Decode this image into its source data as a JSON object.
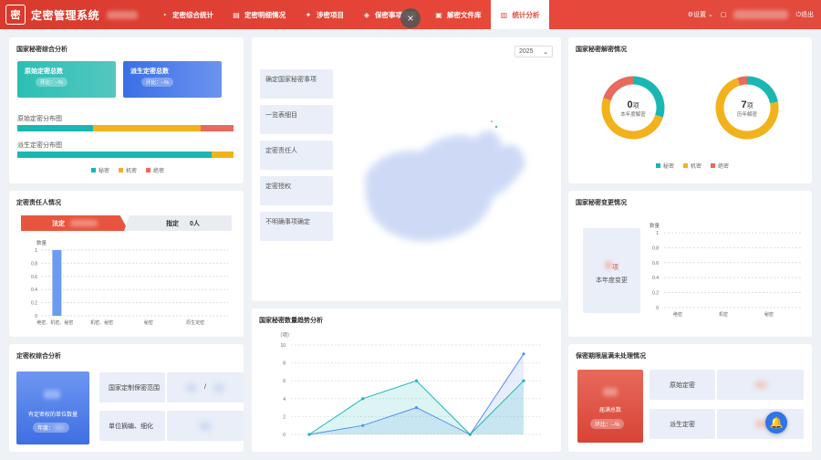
{
  "header": {
    "logo_char": "密",
    "title": "定密管理系统",
    "nav": [
      {
        "icon": "◔",
        "label": "定密综合统计"
      },
      {
        "icon": "▤",
        "label": "定密明细情况"
      },
      {
        "icon": "✦",
        "label": "涉密项目"
      },
      {
        "icon": "◈",
        "label": "保密事项范围"
      },
      {
        "icon": "▣",
        "label": "解密文件库"
      },
      {
        "icon": "▥",
        "label": "统计分析"
      }
    ],
    "close": "×",
    "settings": "设置",
    "logout": "退出"
  },
  "comp": {
    "title": "国家秘密综合分析",
    "orig_total": "原始定密总数",
    "derived_total": "派生定密总数",
    "ratio1": "环比：--%",
    "ratio2": "环比：--%",
    "orig_dist": "原始定密分布图",
    "derived_dist": "派生定密分布图",
    "legend": [
      {
        "name": "秘密",
        "color": "#19b7b4"
      },
      {
        "name": "机密",
        "color": "#f2b21c"
      },
      {
        "name": "绝密",
        "color": "#e86a5c"
      }
    ],
    "orig_bar": [
      0.35,
      0.5,
      0.15
    ],
    "derived_bar": [
      0.9,
      0.1,
      0
    ]
  },
  "resp": {
    "title": "定密责任人情况",
    "legal": "法定",
    "assigned": "指定",
    "assigned_count": "0人",
    "ylabel": "数量",
    "yticks": [
      "1",
      "0.8",
      "0.6",
      "0.4",
      "0.2",
      "0"
    ],
    "cats": [
      "绝密、机密、秘密",
      "机密、秘密",
      "秘密",
      "原生定密"
    ],
    "values": [
      1,
      0,
      0,
      0
    ]
  },
  "auth": {
    "title": "定密权综合分析",
    "box_label": "有定密权的单位数量",
    "year_label": "年度：",
    "scope_label": "国家定制保密范围",
    "slash": "/",
    "unit_label": "单位摘编、细化"
  },
  "center": {
    "year": "2025",
    "items": [
      "确定国家秘密事项",
      "一览表细目",
      "定密责任人",
      "定密授权",
      "不明确事项确定"
    ]
  },
  "trend": {
    "title": "国家秘密数量趋势分析",
    "unit": "（项）",
    "yticks": [
      "10",
      "8",
      "6",
      "4",
      "2",
      "0"
    ]
  },
  "decl": {
    "title": "国家秘密解密情况",
    "year_count": "0",
    "year_unit": "项",
    "year_label": "本年度解密",
    "hist_count": "7",
    "hist_unit": "项",
    "hist_label": "历年解密",
    "legend": [
      {
        "name": "秘密",
        "color": "#19b7b4"
      },
      {
        "name": "机密",
        "color": "#f2b21c"
      },
      {
        "name": "绝密",
        "color": "#e86a5c"
      }
    ]
  },
  "change": {
    "title": "国家秘密变更情况",
    "unit": "项",
    "year_label": "本年度变更",
    "ylabel": "数量",
    "yticks": [
      "1",
      "0.8",
      "0.6",
      "0.4",
      "0.2",
      "0"
    ],
    "cats": [
      "绝密",
      "机密",
      "秘密"
    ]
  },
  "expire": {
    "title": "保密期限届满未处理情况",
    "total_label": "届满总数",
    "ratio": "环比：--%",
    "orig": "原始定密",
    "derived": "派生定密"
  },
  "chart_data": [
    {
      "type": "bar",
      "title": "定密责任人情况",
      "ylabel": "数量",
      "categories": [
        "绝密、机密、秘密",
        "机密、秘密",
        "秘密",
        "原生定密"
      ],
      "values": [
        1,
        0,
        0,
        0
      ],
      "ylim": [
        0,
        1
      ]
    },
    {
      "type": "pie",
      "title": "国家秘密解密情况 本年度解密",
      "labels": [
        "秘密",
        "机密",
        "绝密"
      ],
      "values": [
        0.3,
        0.5,
        0.2
      ]
    },
    {
      "type": "pie",
      "title": "国家秘密解密情况 历年解密",
      "labels": [
        "秘密",
        "机密",
        "绝密"
      ],
      "values": [
        0.22,
        0.73,
        0.05
      ]
    },
    {
      "type": "area",
      "title": "国家秘密数量趋势分析",
      "ylabel": "（项）",
      "ylim": [
        0,
        10
      ],
      "series": [
        {
          "name": "秘密",
          "values": [
            0,
            4,
            6,
            0,
            6
          ],
          "color": "#19b7b4"
        },
        {
          "name": "机密",
          "values": [
            0,
            1,
            3,
            0,
            9
          ],
          "color": "#5b8ff0"
        }
      ]
    }
  ]
}
